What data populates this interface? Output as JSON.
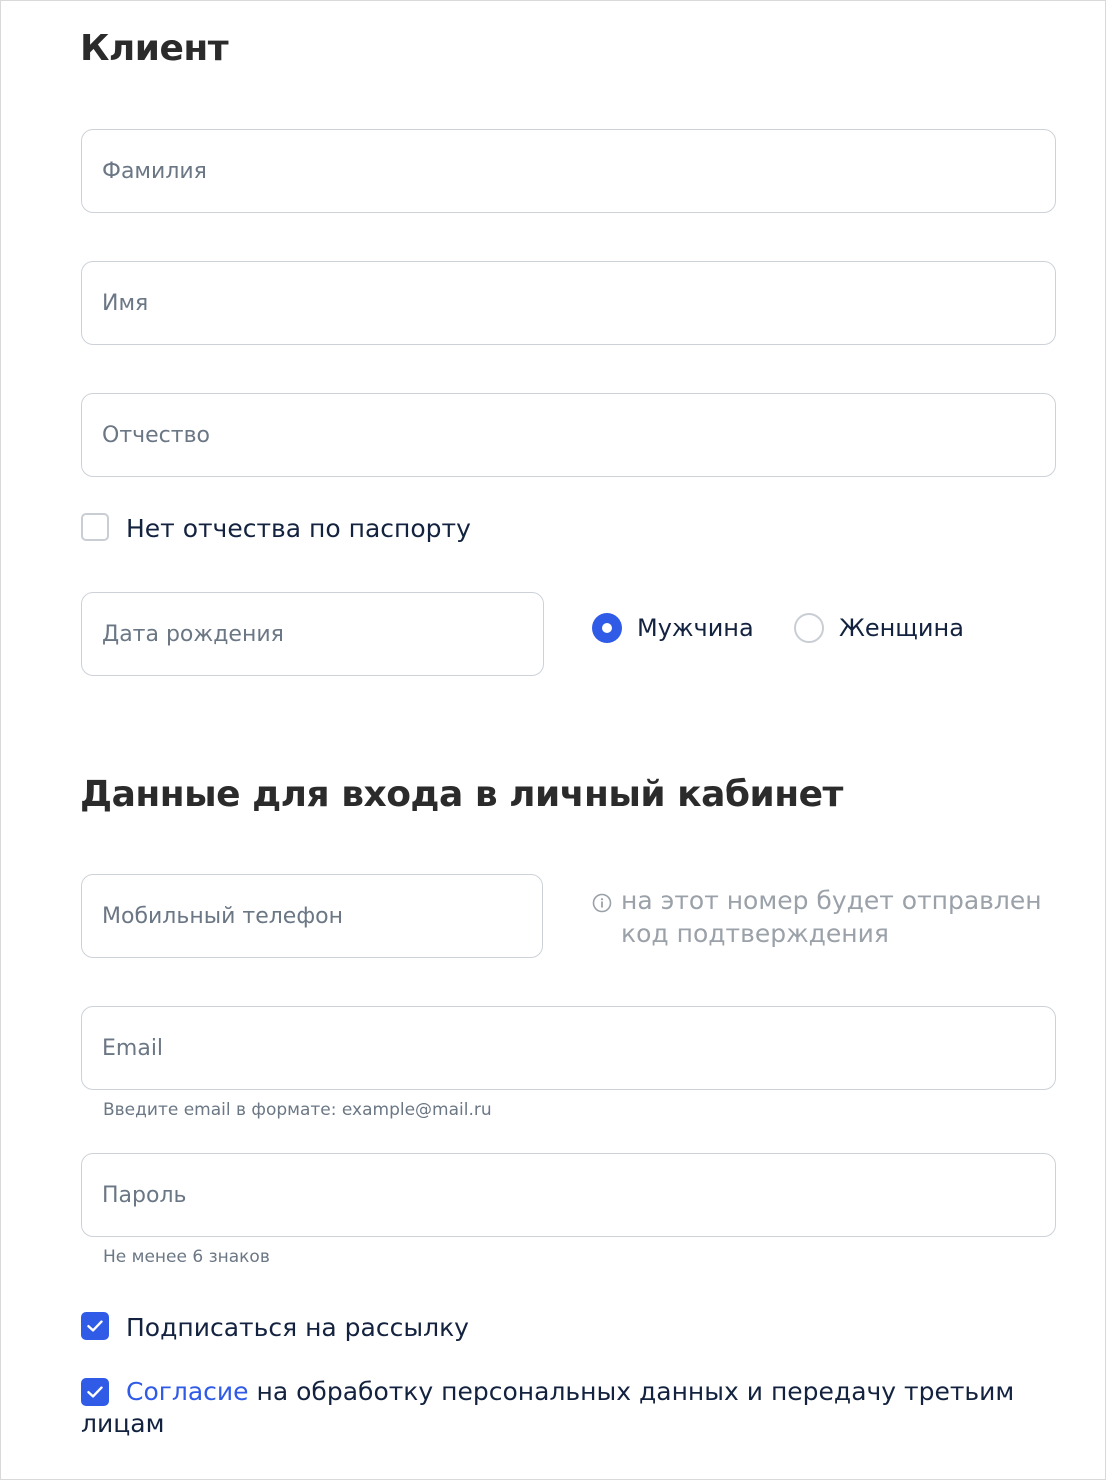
{
  "client": {
    "title": "Клиент",
    "last_name_placeholder": "Фамилия",
    "first_name_placeholder": "Имя",
    "patronymic_placeholder": "Отчество",
    "no_patronymic_label": "Нет отчества по паспорту",
    "no_patronymic_checked": false,
    "birth_date_placeholder": "Дата рождения",
    "gender": {
      "male_label": "Мужчина",
      "female_label": "Женщина",
      "selected": "male"
    }
  },
  "login": {
    "title": "Данные для входа в личный кабинет",
    "phone_placeholder": "Мобильный телефон",
    "phone_hint": "на этот номер будет отправлен код подтверждения",
    "email_placeholder": "Email",
    "email_hint": "Введите email в формате: example@mail.ru",
    "password_placeholder": "Пароль",
    "password_hint": "Не менее 6 знаков",
    "subscribe_label": "Подписаться на рассылку",
    "subscribe_checked": true,
    "consent_link": "Согласие",
    "consent_text": " на обработку персональных данных и передачу третьим лицам",
    "consent_checked": true
  },
  "colors": {
    "accent": "#2f5be7",
    "text": "#13223f",
    "placeholder": "#6b7785",
    "hint": "#9aa1a9"
  },
  "icons": {
    "check": "checkmark-icon",
    "info": "info-circle-icon"
  }
}
